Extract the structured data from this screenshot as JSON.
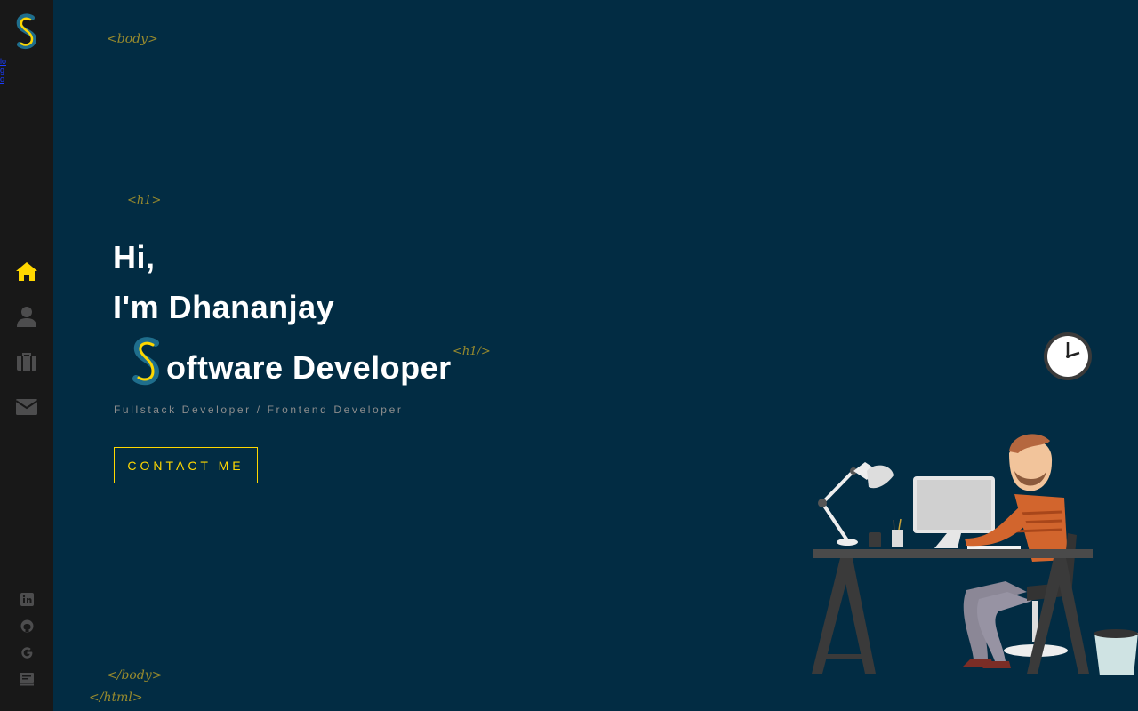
{
  "tags": {
    "body_open": "<body>",
    "h1_open": "<h1>",
    "h1_close": "<h1/>",
    "body_close": "</body>",
    "html_close": "</html>"
  },
  "hero": {
    "line1": "Hi,",
    "line2": "I'm  Dhananjay",
    "line3_rest": "oftware Developer",
    "subtitle": "Fullstack Developer / Frontend Developer",
    "cta_label": "CONTACT ME"
  },
  "sidebar": {
    "logo_sub": "logo",
    "nav": [
      {
        "icon": "home-icon",
        "active": true
      },
      {
        "icon": "user-icon",
        "active": false
      },
      {
        "icon": "briefcase-icon",
        "active": false
      },
      {
        "icon": "envelope-icon",
        "active": false
      }
    ],
    "social": [
      "linkedin-icon",
      "github-icon",
      "google-icon",
      "message-icon"
    ]
  },
  "colors": {
    "background": "#022c43",
    "sidebar": "#181818",
    "accent": "#ffd700",
    "tag": "#b39b2a",
    "inactive_icon": "#4d4d4e"
  }
}
